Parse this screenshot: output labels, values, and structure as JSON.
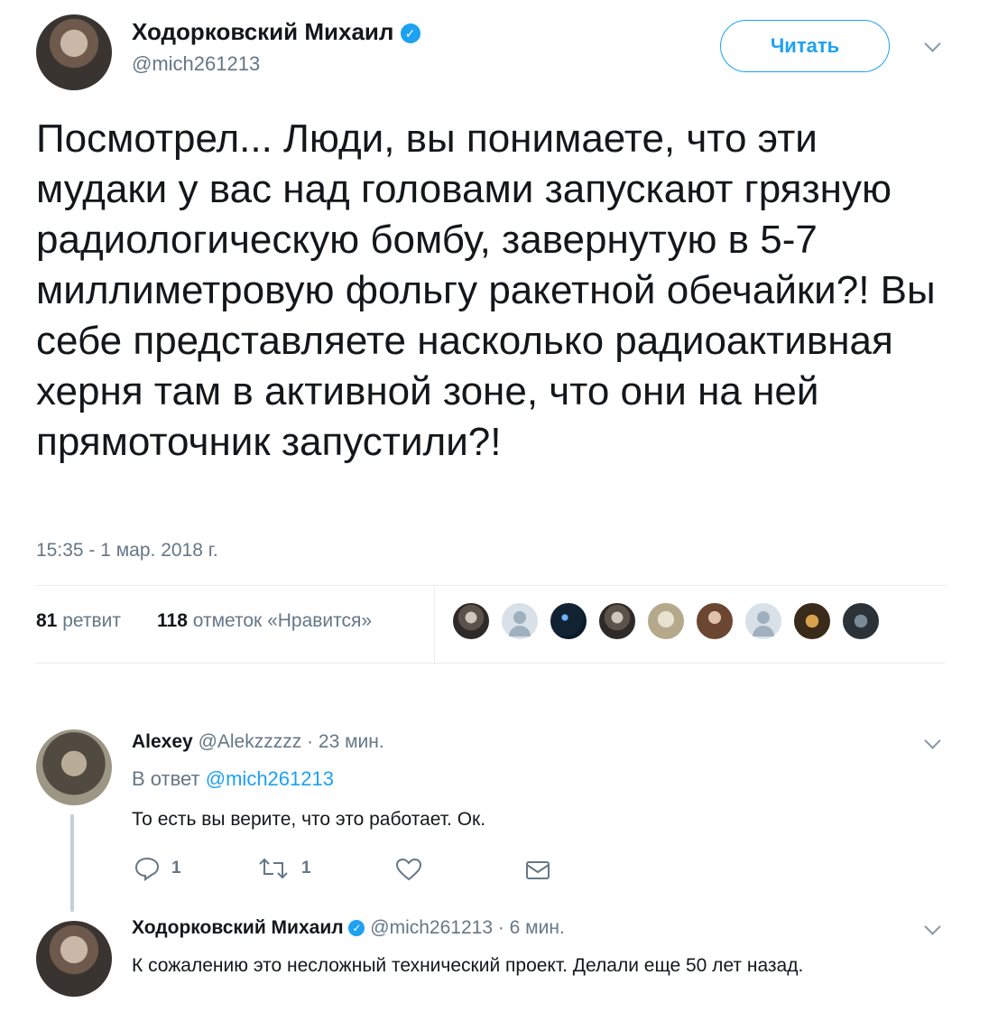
{
  "main_tweet": {
    "author_name": "Ходорковский Михаил",
    "author_handle": "@mich261213",
    "follow_label": "Читать",
    "text": "Посмотрел... Люди, вы понимаете, что эти мудаки у вас над головами запускают грязную радиологическую бомбу, завернутую в 5-7 миллиметровую фольгу ракетной обечайки?! Вы себе представляете насколько радиоактивная херня там в активной зоне, что они на ней прямоточник запустили?!",
    "timestamp": "15:35 - 1 мар. 2018 г.",
    "retweets_count": "81",
    "retweets_label": "ретвит",
    "likes_count": "118",
    "likes_label": "отметок «Нравится»"
  },
  "reply_1": {
    "author_name": "Alexey",
    "author_handle": "@Alekzzzzz",
    "time": "· 23 мин.",
    "reply_to_prefix": "В ответ",
    "reply_to_handle": "@mich261213",
    "text": "То есть вы верите, что это работает. Ок.",
    "reply_count": "1",
    "retweet_count": "1"
  },
  "reply_2": {
    "author_name": "Ходорковский Михаил",
    "author_handle": "@mich261213",
    "time": "· 6 мин.",
    "text": "К сожалению это несложный технический проект. Делали еще 50 лет назад."
  },
  "colors": {
    "accent": "#1da1f2",
    "muted": "#657786",
    "divider": "#e6ecf0"
  }
}
